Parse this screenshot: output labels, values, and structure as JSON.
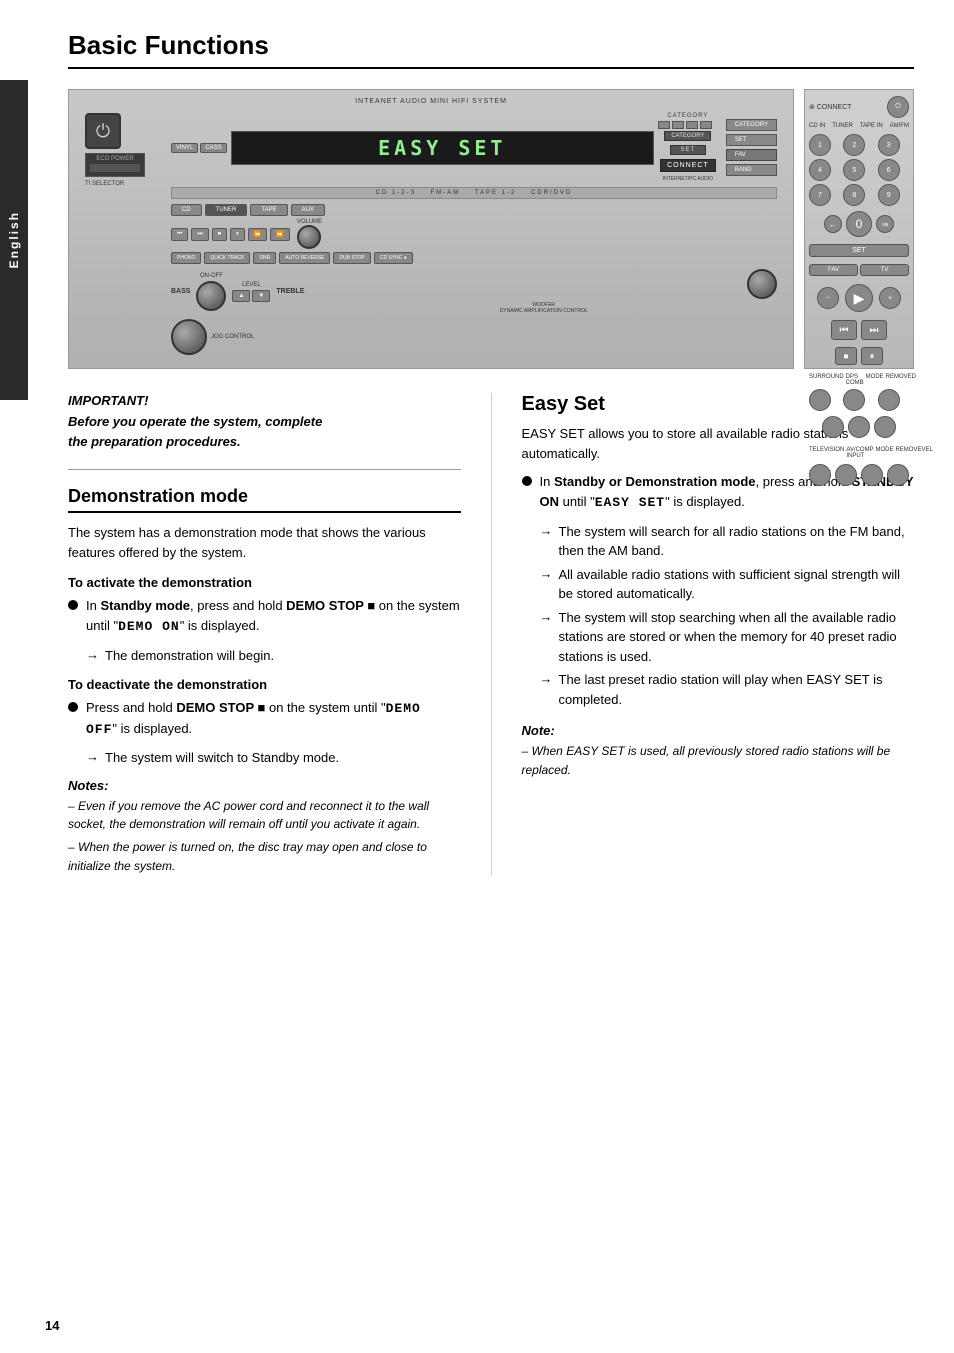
{
  "page": {
    "title": "Basic Functions",
    "number": "14",
    "sidebar_label": "English"
  },
  "device": {
    "display_text": "EASY SET",
    "label": "INTEANET AUDIO MINI HIFI SYSTEM"
  },
  "important": {
    "label": "IMPORTANT!",
    "text_line1": "Before you operate the system, complete",
    "text_line2": "the preparation procedures."
  },
  "demonstration": {
    "section_title": "Demonstration mode",
    "intro": "The system has a demonstration mode that shows the various features offered by the system.",
    "activate_title": "To activate the demonstration",
    "activate_bullet": "In Standby mode, press and hold DEMO STOP ■ on the system until \"DEMO ON\" is displayed.",
    "activate_arrow": "The demonstration will begin.",
    "deactivate_title": "To deactivate the demonstration",
    "deactivate_bullet_pre": "Press and hold ",
    "deactivate_bullet_bold": "DEMO STOP ■",
    "deactivate_bullet_post": " on the system until \"DEMO OFF\" is displayed.",
    "deactivate_arrow": "The system will switch to Standby mode.",
    "notes_label": "Notes:",
    "note1": "– Even if you remove the AC power cord and reconnect it to the wall socket, the demonstration will remain off until you activate it again.",
    "note2": "– When the power is turned on, the disc tray may open and close to initialize the system."
  },
  "easy_set": {
    "section_title": "Easy Set",
    "intro": "EASY SET allows you to store all available radio stations automatically.",
    "bullet1_pre": "In ",
    "bullet1_bold": "Standby or Demonstration mode",
    "bullet1_post": ", press and hold ",
    "bullet1_bold2": "STANDBY ON",
    "bullet1_post2": " until \"EASY SET\" is displayed.",
    "arrow1": "The system will search for all radio stations on the FM band, then the AM band.",
    "arrow2": "All available radio stations with sufficient signal strength will be stored automatically.",
    "arrow3": "The system will stop searching when all the available radio stations are stored or when the memory for 40 preset radio stations is used.",
    "arrow4": "The last preset radio station will play when EASY SET is completed.",
    "note_label": "Note:",
    "note_italic": "– When EASY SET is used, all previously stored radio stations will be replaced."
  },
  "icons": {
    "bullet": "●",
    "arrow": "→",
    "stop": "■"
  }
}
